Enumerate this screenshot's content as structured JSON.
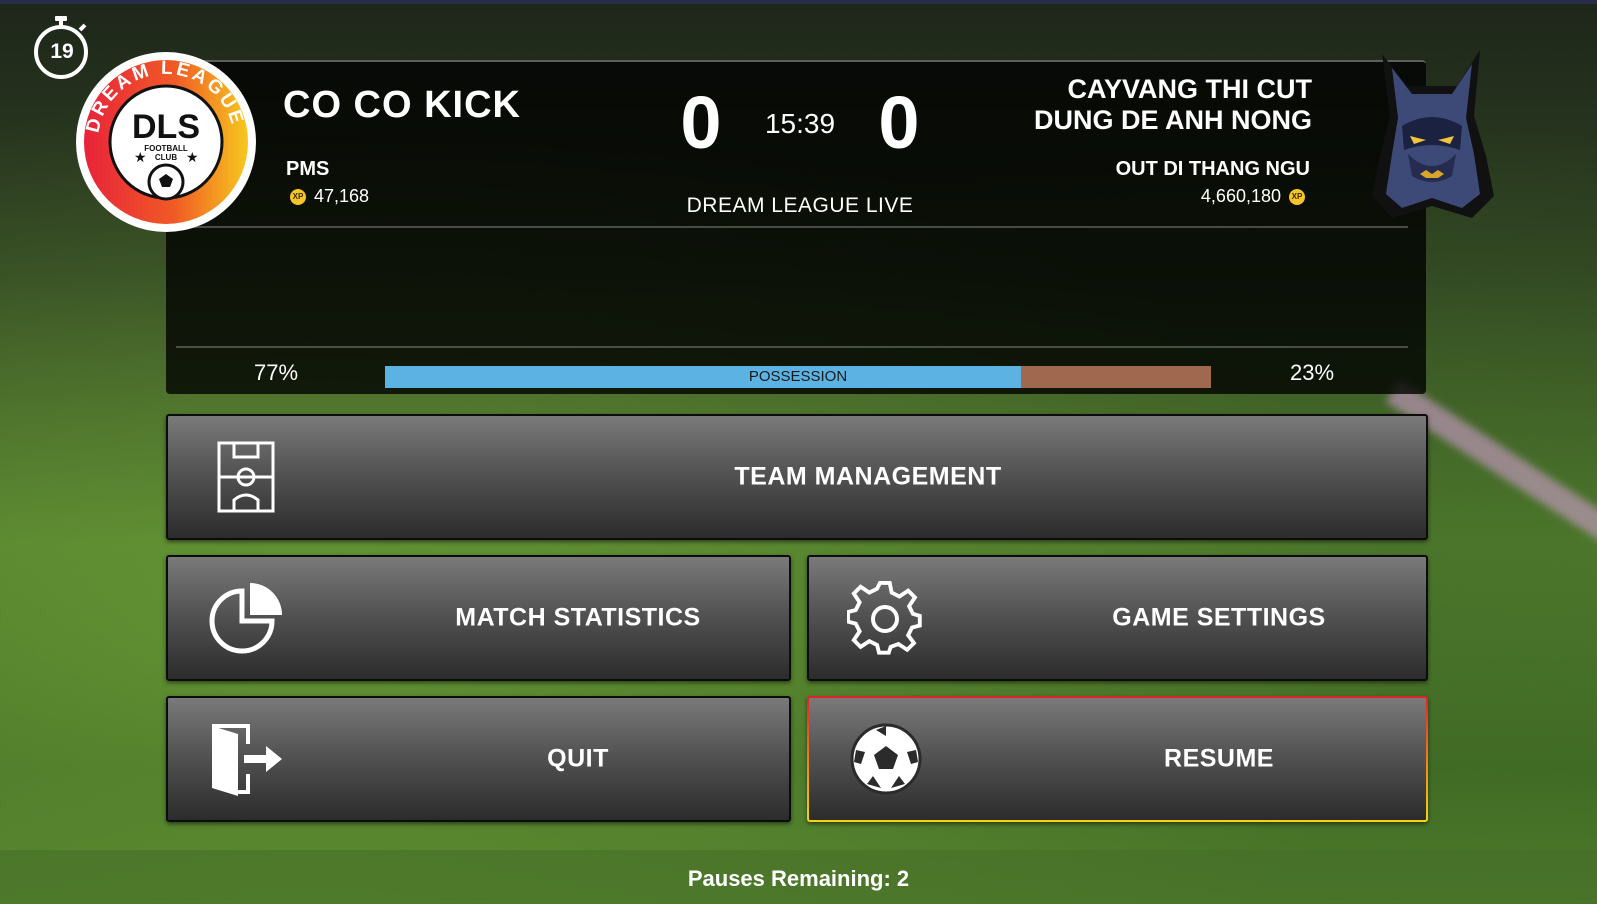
{
  "timer": {
    "value": "19"
  },
  "home": {
    "team_name": "CO CO KICK",
    "manager": "PMS",
    "xp": "47,168",
    "logo_text": {
      "main": "DLS",
      "sub1": "FOOTBALL",
      "sub2": "CLUB",
      "ring": "DREAM LEAGUE"
    }
  },
  "away": {
    "team_name_line1": "CAYVANG THI CUT",
    "team_name_line2": "DUNG DE ANH NONG",
    "manager": "OUT DI THANG NGU",
    "xp": "4,660,180"
  },
  "xp_badge": "XP",
  "score": {
    "home": "0",
    "away": "0",
    "clock": "15:39"
  },
  "league": "DREAM LEAGUE LIVE",
  "possession": {
    "label": "POSSESSION",
    "home_pct": "77%",
    "away_pct": "23%",
    "home_value": 77,
    "away_value": 23,
    "home_color": "#5db2e4",
    "away_color": "#a0684e"
  },
  "buttons": {
    "team_management": "TEAM MANAGEMENT",
    "match_statistics": "MATCH STATISTICS",
    "game_settings": "GAME SETTINGS",
    "quit": "QUIT",
    "resume": "RESUME"
  },
  "icons": {
    "team_management": "pitch-formation-icon",
    "match_statistics": "pie-chart-icon",
    "game_settings": "gear-icon",
    "quit": "exit-door-icon",
    "resume": "soccer-ball-icon"
  },
  "footer": "Pauses Remaining: 2"
}
